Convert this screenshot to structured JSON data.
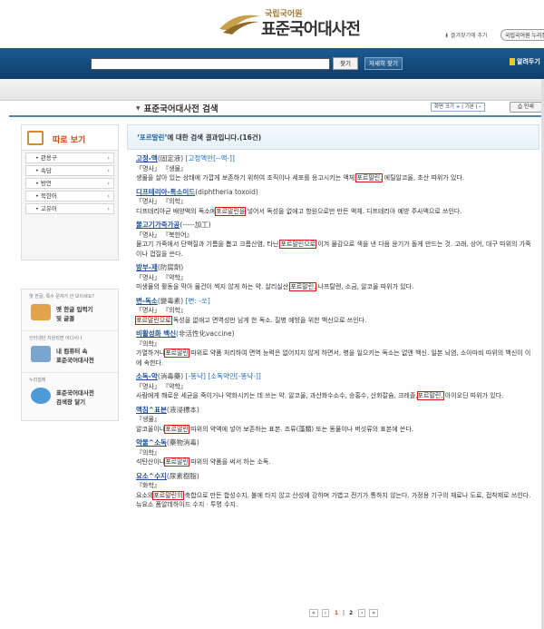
{
  "header": {
    "logo_small": "국립국어원",
    "logo_big": "표준국어대사전",
    "favorites_link": "즐겨찾기에 추가",
    "top_button": "국립국어원 누리집"
  },
  "search": {
    "search_button": "찾기",
    "advanced_button": "자세히 찾기",
    "notice": "알려두기"
  },
  "page": {
    "title": "표준국어대사전 검색",
    "font_size_label": "화면 크기",
    "font_plus": "+",
    "font_default": "기본",
    "font_minus": "-",
    "print_button": "인쇄"
  },
  "sidebar": {
    "title": "따로 보기",
    "items": [
      {
        "label": "관용구"
      },
      {
        "label": "속담"
      },
      {
        "label": "방언"
      },
      {
        "label": "북한어"
      },
      {
        "label": "고유어"
      }
    ]
  },
  "promo": [
    {
      "caption": "옛 한글, 특수 문자가 안 보이세요?",
      "line1": "옛 한글 입력기",
      "line2": "및 글꼴"
    },
    {
      "caption": "인터넷만 지원되면 어디서나",
      "line1": "내 컴퓨터 속",
      "line2": "표준국어대사전"
    },
    {
      "caption": "누리집에",
      "line1": "표준국어대사전",
      "line2": "검색창 달기"
    }
  ],
  "results": {
    "query": "‘포르말린’",
    "summary": "에 대한 검색 결과입니다.(16건)",
    "entries": [
      {
        "headword": "고정-액",
        "orig": "(固定液)",
        "ref": "[고정액만[--액-]]",
        "pos": "「명사」 『생물』",
        "def_before": "생물을 살아 있는 상태에 가깝게 보존하기 위하여 조직이나 세포를 응고시키는 액체.",
        "hl": "포르말린,",
        "def_after": " 에틸알코올, 초산 따위가 있다."
      },
      {
        "headword": "디프테리아-톡소이드",
        "orig": "(diphtheria toxoid)",
        "ref": "",
        "pos": "「명사」 『의학』",
        "def_before": "디프테리아균 배양액의 독소에",
        "hl": "포르말린을",
        "def_after": " 넣어서 독성을 없애고 항원으로만 만든 액체. 디프테리아 예방 주사액으로 쓰인다."
      },
      {
        "headword": "물고기가죽가공",
        "orig": "(-----加工)",
        "ref": "",
        "pos": "「명사」 『북한어』",
        "def_before": "물고기 가죽에서 단백질과 기름을 뽑고 크롬산염, 타닌,",
        "hl": "포르말린으로",
        "def_after": " 이겨 물감으로 색을 낸 다음 윤기가 돌게 만드는 것. 고래, 상어, 대구 따위의 가죽이나 껍질을 쓴다."
      },
      {
        "headword": "방부-제",
        "orig": "(防腐劑)",
        "ref": "",
        "pos": "「명사」 『약학』",
        "def_before": "미생물의 활동을 막아 물건이 썩지 않게 하는 약. 살리실산,",
        "hl": "포르말린,",
        "def_after": " 나프탈렌, 소금, 알코올 따위가 있다."
      },
      {
        "headword": "변-독소",
        "orig": "(變毒素)",
        "ref": "[변: -쏘]",
        "pos": "「명사」 『의학』",
        "def_before": "",
        "hl": "포르말린으로",
        "def_after": " 독성을 없애고 면역성만 남게 한 독소. 질병 예방을 위한 백신으로 쓰인다."
      },
      {
        "headword": "비활성화 백신",
        "orig": "(非活性化vaccine)",
        "ref": "",
        "pos": "『의학』",
        "def_before": "가열하거나",
        "hl": "포르말린",
        "def_after": " 따위로 약품 처리하여 면역 능력은 없어지지 않게 하면서, 병을 일으키는 독소는 없앤 백신. 일본 뇌염, 소아마비 따위의 백신이 이에 속한다."
      },
      {
        "headword": "소독-약",
        "orig": "(消毒藥)",
        "ref": "[-똥냑] [소독약만[-똥냑-]]",
        "pos": "「명사」 『약학』",
        "def_before": "사람에게 해로운 세균을 죽이거나 약화시키는 데 쓰는 약. 알코올, 과산화수소수, 승홍수, 산화칼슘, 크레졸,",
        "hl": "포르말린,",
        "def_after": " 아이오딘 따위가 있다."
      },
      {
        "headword": "액침^표본",
        "orig": "(液浸標本)",
        "ref": "",
        "pos": "『생물』",
        "def_before": "알코올이나",
        "hl": "포르말린",
        "def_after": " 따위의 약액에 넣어 보존하는 표본. 조류(藻類) 또는 동물이나 버섯류의 표본에 쓴다."
      },
      {
        "headword": "약물^소독",
        "orig": "(藥物消毒)",
        "ref": "",
        "pos": "『의학』",
        "def_before": "석탄산이나",
        "hl": "포르말린",
        "def_after": " 따위의 약품을 써서 하는 소독."
      },
      {
        "headword": "요소^수지",
        "orig": "(尿素樹脂)",
        "ref": "",
        "pos": "『화학』",
        "def_before": "요소와",
        "hl": "포르말린의",
        "def_after": " 축합으로 만든 합성수지. 불에 타지 않고 산성에 강하며 가볍고 전기가 통하지 않는다. 가정용 기구의 재료나 도료, 접착제로 쓰인다. 뉴요소 폼알데하이드 수지 · 투명 수지."
      }
    ]
  },
  "pager": {
    "prev_first": "«",
    "prev": "‹",
    "page1": "1",
    "page2": "2",
    "next": "›",
    "last": "»"
  },
  "colors": {
    "accent_blue": "#1b5b93",
    "highlight_red": "#d61a1a",
    "sidebar_orange": "#d04a10"
  }
}
